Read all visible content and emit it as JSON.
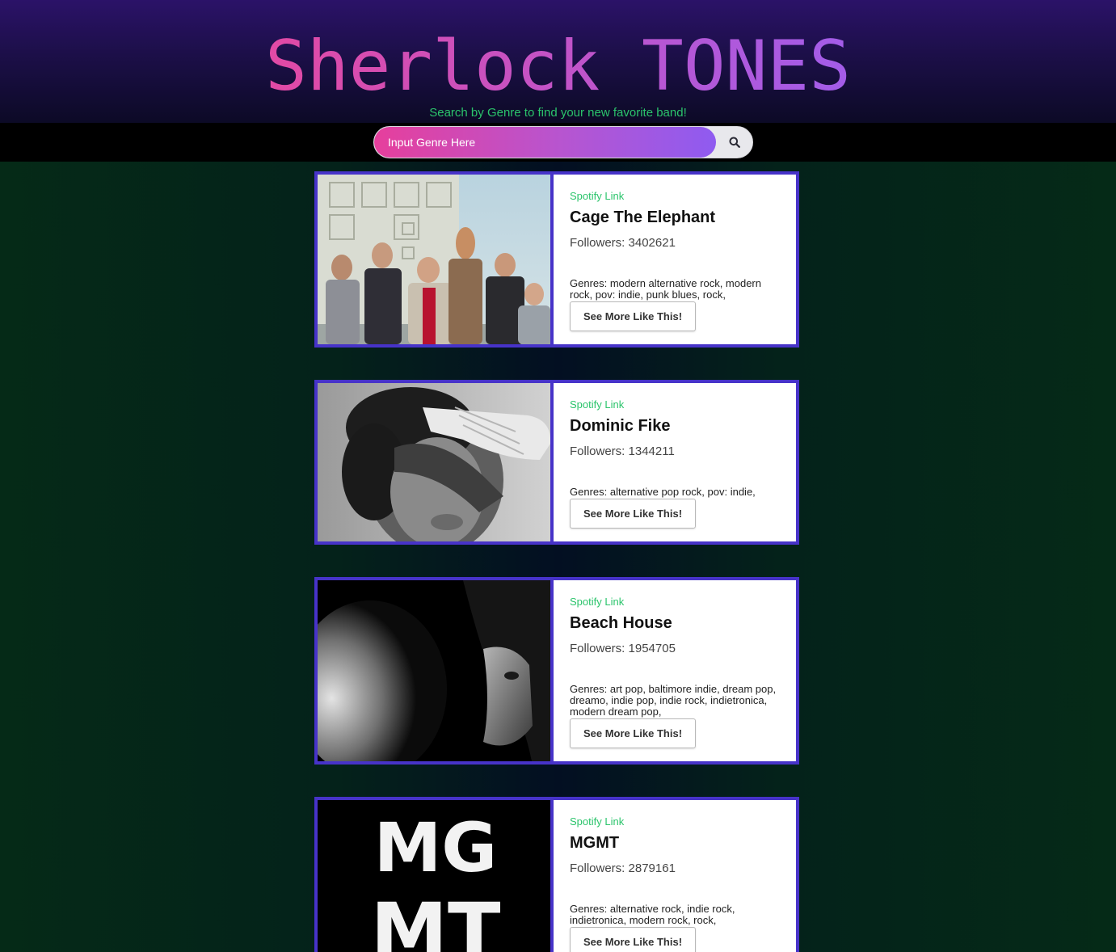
{
  "header": {
    "title": "Sherlock TONES",
    "subtitle": "Search by Genre to find your new favorite band!"
  },
  "search": {
    "placeholder": "Input Genre Here",
    "button_icon": "search-icon"
  },
  "colors": {
    "accent_green": "#2bc46b",
    "card_border": "#4733c9",
    "title_gradient_start": "#e04aa6",
    "title_gradient_end": "#a45ce8"
  },
  "results": [
    {
      "link_label": "Spotify Link",
      "name": "Cage The Elephant",
      "followers": "Followers: 3402621",
      "genres": "Genres: modern alternative rock, modern rock, pov: indie, punk blues, rock,",
      "button_label": "See More Like This!"
    },
    {
      "link_label": "Spotify Link",
      "name": "Dominic Fike",
      "followers": "Followers: 1344211",
      "genres": "Genres: alternative pop rock, pov: indie,",
      "button_label": "See More Like This!"
    },
    {
      "link_label": "Spotify Link",
      "name": "Beach House",
      "followers": "Followers: 1954705",
      "genres": "Genres: art pop, baltimore indie, dream pop, dreamo, indie pop, indie rock, indietronica, modern dream pop,",
      "button_label": "See More Like This!"
    },
    {
      "link_label": "Spotify Link",
      "name": "MGMT",
      "followers": "Followers: 2879161",
      "genres": "Genres: alternative rock, indie rock, indietronica, modern rock, rock,",
      "button_label": "See More Like This!",
      "image_text": "MG MT"
    }
  ]
}
